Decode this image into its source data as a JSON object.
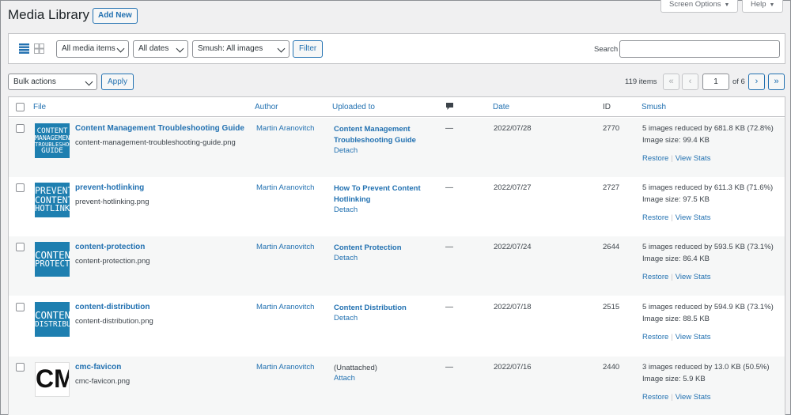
{
  "header": {
    "title": "Media Library",
    "add_new": "Add New",
    "screen_options": "Screen Options",
    "help": "Help"
  },
  "toolbar": {
    "media_filter": "All media items",
    "date_filter": "All dates",
    "smush_filter": "Smush: All images",
    "filter_button": "Filter",
    "search_label": "Search",
    "search_value": ""
  },
  "bulk": {
    "action": "Bulk actions",
    "apply": "Apply"
  },
  "pagination": {
    "items_count": "119 items",
    "first": "«",
    "prev": "‹",
    "current_page": "1",
    "of_pages": "of 6",
    "next": "›",
    "last": "»"
  },
  "columns": {
    "file": "File",
    "author": "Author",
    "uploaded_to": "Uploaded to",
    "date": "Date",
    "id": "ID",
    "smush": "Smush"
  },
  "rows": [
    {
      "thumb_lines": [
        "CONTENT",
        "MANAGEMENT",
        "TROUBLESHOOTING",
        "GUIDE"
      ],
      "title": "Content Management Troubleshooting Guide",
      "filename": "content-management-troubleshooting-guide.png",
      "author": "Martin Aranovitch",
      "uploaded_line1": "Content Management",
      "uploaded_line2": "Troubleshooting Guide",
      "attach_action": "Detach",
      "comments": "—",
      "date": "2022/07/28",
      "id": "2770",
      "smush_summary": "5 images reduced by 681.8 KB (72.8%)",
      "image_size": "Image size: 99.4 KB",
      "restore": "Restore",
      "view_stats": "View Stats"
    },
    {
      "thumb_lines": [
        "PREVENT",
        "CONTENT",
        "HOTLINKING"
      ],
      "title": "prevent-hotlinking",
      "filename": "prevent-hotlinking.png",
      "author": "Martin Aranovitch",
      "uploaded_line1": "How To Prevent Content",
      "uploaded_line2": "Hotlinking",
      "attach_action": "Detach",
      "comments": "—",
      "date": "2022/07/27",
      "id": "2727",
      "smush_summary": "5 images reduced by 611.3 KB (71.6%)",
      "image_size": "Image size: 97.5 KB",
      "restore": "Restore",
      "view_stats": "View Stats"
    },
    {
      "thumb_lines": [
        "CONTENT",
        "PROTECTION"
      ],
      "title": "content-protection",
      "filename": "content-protection.png",
      "author": "Martin Aranovitch",
      "uploaded_line1": "Content Protection",
      "uploaded_line2": "",
      "attach_action": "Detach",
      "comments": "—",
      "date": "2022/07/24",
      "id": "2644",
      "smush_summary": "5 images reduced by 593.5 KB (73.1%)",
      "image_size": "Image size: 86.4 KB",
      "restore": "Restore",
      "view_stats": "View Stats"
    },
    {
      "thumb_lines": [
        "CONTENT",
        "DISTRIBUTION"
      ],
      "title": "content-distribution",
      "filename": "content-distribution.png",
      "author": "Martin Aranovitch",
      "uploaded_line1": "Content Distribution",
      "uploaded_line2": "",
      "attach_action": "Detach",
      "comments": "—",
      "date": "2022/07/18",
      "id": "2515",
      "smush_summary": "5 images reduced by 594.9 KB (73.1%)",
      "image_size": "Image size: 88.5 KB",
      "restore": "Restore",
      "view_stats": "View Stats"
    },
    {
      "thumb_lines": [
        "CMC"
      ],
      "title": "cmc-favicon",
      "filename": "cmc-favicon.png",
      "author": "Martin Aranovitch",
      "uploaded_line1": "(Unattached)",
      "uploaded_line2": "",
      "attach_action": "Attach",
      "comments": "—",
      "date": "2022/07/16",
      "id": "2440",
      "smush_summary": "3 images reduced by 13.0 KB (50.5%)",
      "image_size": "Image size: 5.9 KB",
      "restore": "Restore",
      "view_stats": "View Stats"
    }
  ]
}
